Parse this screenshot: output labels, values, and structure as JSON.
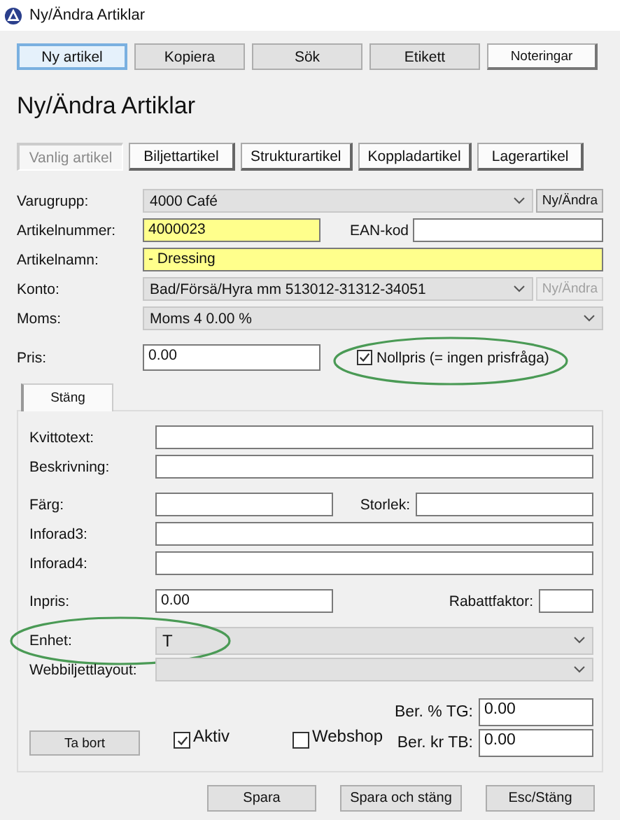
{
  "window": {
    "title": "Ny/Ändra Artiklar"
  },
  "toolbar": [
    {
      "label": "Ny artikel",
      "selected": true
    },
    {
      "label": "Kopiera",
      "selected": false
    },
    {
      "label": "Sök",
      "selected": false
    },
    {
      "label": "Etikett",
      "selected": false
    },
    {
      "label": "Noteringar",
      "selected": false
    }
  ],
  "heading": "Ny/Ändra Artiklar",
  "tabs": [
    {
      "label": "Vanlig artikel",
      "selected": true
    },
    {
      "label": "Biljettartikel",
      "selected": false
    },
    {
      "label": "Strukturartikel",
      "selected": false
    },
    {
      "label": "Koppladartikel",
      "selected": false
    },
    {
      "label": "Lagerartikel",
      "selected": false
    }
  ],
  "varugrupp": {
    "label": "Varugrupp:",
    "value": "4000 Café",
    "button": {
      "label": "Ny/Ändra",
      "disabled": false
    }
  },
  "artikelnummer": {
    "label": "Artikelnummer:",
    "value": "4000023",
    "required": true
  },
  "ean": {
    "label": "EAN-kod"
  },
  "artikelnamn": {
    "label": "Artikelnamn:",
    "value": "- Dressing",
    "required": true
  },
  "konto": {
    "label": "Konto:",
    "value": "Bad/Försä/Hyra mm 513012-31312-34051",
    "button": {
      "label": "Ny/Ändra",
      "disabled": true
    }
  },
  "moms": {
    "label": "Moms:",
    "value": "Moms 4  0.00 %"
  },
  "pris": {
    "label": "Pris:",
    "value": "0.00"
  },
  "nollpris": {
    "label": "Nollpris (= ingen prisfråga)",
    "checked": true,
    "circled": true
  },
  "panel_tabs": [
    {
      "label": "Stäng",
      "selected": true
    }
  ],
  "kvittotext": {
    "label": "Kvittotext:"
  },
  "beskrivning": {
    "label": "Beskrivning:"
  },
  "farg": {
    "label": "Färg:"
  },
  "storlek": {
    "label": "Storlek:"
  },
  "inforad3": {
    "label": "Inforad3:"
  },
  "inforad4": {
    "label": "Inforad4:"
  },
  "inpris": {
    "label": "Inpris:",
    "value": "0.00"
  },
  "rabattfaktor": {
    "label": "Rabattfaktor:"
  },
  "enhet": {
    "label": "Enhet:",
    "value": "T",
    "circled": true
  },
  "webbiljettlayout": {
    "label": "Webbiljettlayout:"
  },
  "ber_tg": {
    "label": "Ber. % TG:",
    "value": "0.00"
  },
  "ber_tb": {
    "label": "Ber. kr TB:",
    "value": "0.00"
  },
  "delete_button": "Ta bort",
  "aktiv": {
    "label": "Aktiv",
    "checked": true
  },
  "webshop": {
    "label": "Webshop",
    "checked": false
  },
  "footer_buttons": [
    "Spara",
    "Spara och stäng",
    "Esc/Stäng"
  ]
}
